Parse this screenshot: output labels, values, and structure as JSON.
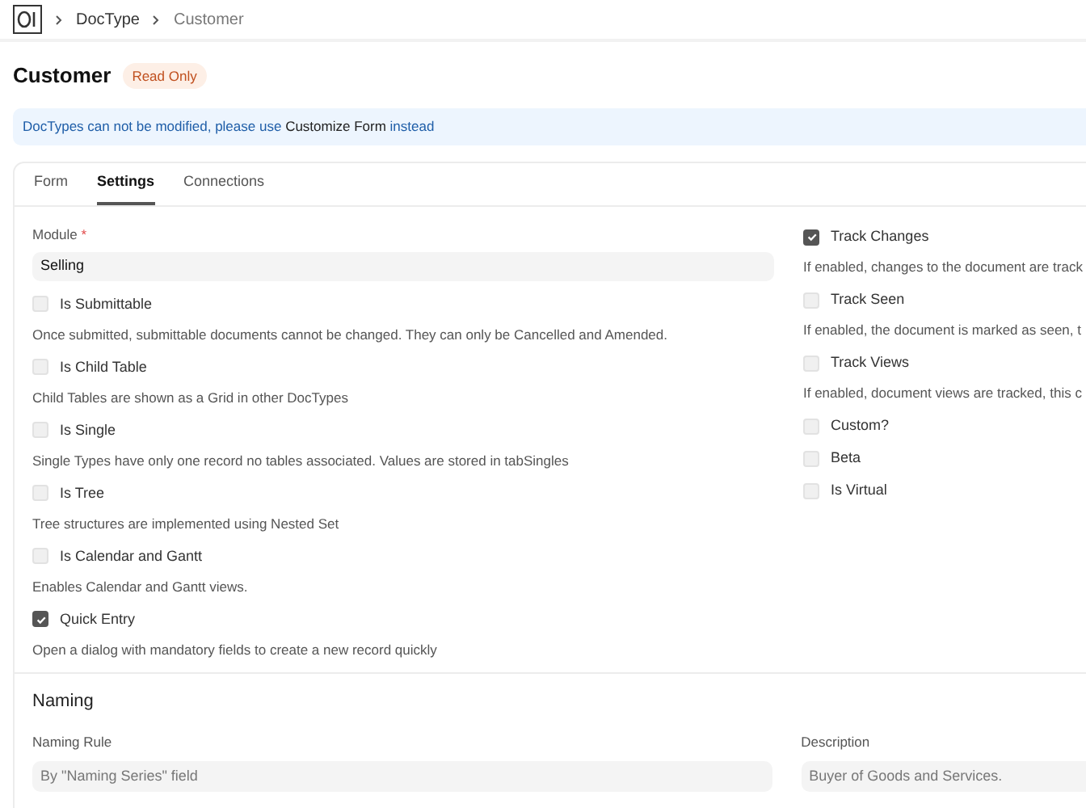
{
  "breadcrumbs": [
    "DocType",
    "Customer"
  ],
  "title": "Customer",
  "status_badge": "Read Only",
  "banner": {
    "text_before": "DocTypes can not be modified, please use",
    "link": "Customize Form",
    "text_after": "instead"
  },
  "tabs": [
    {
      "label": "Form",
      "selected": false
    },
    {
      "label": "Settings",
      "selected": true
    },
    {
      "label": "Connections",
      "selected": false
    }
  ],
  "module": {
    "label": "Module",
    "required_mark": "*",
    "value": "Selling"
  },
  "left_checks": [
    {
      "label": "Is Submittable",
      "checked": false,
      "description": "Once submitted, submittable documents cannot be changed. They can only be Cancelled and Amended."
    },
    {
      "label": "Is Child Table",
      "checked": false,
      "description": "Child Tables are shown as a Grid in other DocTypes"
    },
    {
      "label": "Is Single",
      "checked": false,
      "description": "Single Types have only one record no tables associated. Values are stored in tabSingles"
    },
    {
      "label": "Is Tree",
      "checked": false,
      "description": "Tree structures are implemented using Nested Set"
    },
    {
      "label": "Is Calendar and Gantt",
      "checked": false,
      "description": "Enables Calendar and Gantt views."
    },
    {
      "label": "Quick Entry",
      "checked": true,
      "description": "Open a dialog with mandatory fields to create a new record quickly"
    }
  ],
  "right_checks": [
    {
      "label": "Track Changes",
      "checked": true,
      "description": "If enabled, changes to the document are track"
    },
    {
      "label": "Track Seen",
      "checked": false,
      "description": "If enabled, the document is marked as seen, t"
    },
    {
      "label": "Track Views",
      "checked": false,
      "description": "If enabled, document views are tracked, this c"
    },
    {
      "label": "Custom?",
      "checked": false
    },
    {
      "label": "Beta",
      "checked": false
    },
    {
      "label": "Is Virtual",
      "checked": false
    }
  ],
  "naming": {
    "heading": "Naming",
    "naming_rule": {
      "label": "Naming Rule",
      "value": "By \"Naming Series\" field"
    },
    "description": {
      "label": "Description",
      "value": "Buyer of Goods and Services."
    }
  }
}
